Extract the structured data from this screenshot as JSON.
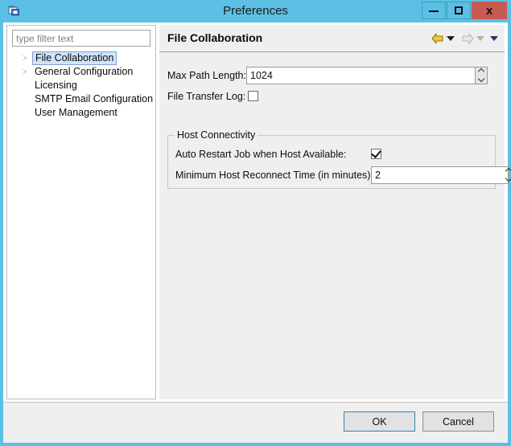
{
  "window": {
    "title": "Preferences",
    "icon": "folder-window-icon",
    "controls": {
      "minimize": "–",
      "maximize": "▢",
      "close": "x"
    },
    "accent_title_bar": "#5cc0e4",
    "accent_close": "#c75b51"
  },
  "sidebar": {
    "filter": {
      "placeholder": "type filter text",
      "value": ""
    },
    "items": [
      {
        "label": "File Collaboration",
        "expandable": true,
        "selected": true
      },
      {
        "label": "General Configuration",
        "expandable": true,
        "selected": false
      },
      {
        "label": "Licensing",
        "expandable": false,
        "selected": false
      },
      {
        "label": "SMTP Email Configuration",
        "expandable": false,
        "selected": false
      },
      {
        "label": "User Management",
        "expandable": false,
        "selected": false
      }
    ]
  },
  "content": {
    "title": "File Collaboration",
    "nav": {
      "back": "back-arrow",
      "back_menu": "back-dropdown",
      "forward": "forward-arrow",
      "forward_menu": "forward-dropdown",
      "menu": "view-menu",
      "back_color": "#e8b230",
      "forward_color": "#d8d8d8",
      "menu_color": "#3b2d63"
    },
    "fields": {
      "max_path_length": {
        "label": "Max Path Length:",
        "value": "1024"
      },
      "file_transfer_log": {
        "label": "File Transfer Log:",
        "checked": false
      }
    },
    "group": {
      "legend": "Host Connectivity",
      "auto_restart": {
        "label": "Auto Restart Job when Host Available:",
        "checked": true
      },
      "min_reconnect": {
        "label": "Minimum Host Reconnect Time (in minutes):",
        "value": "2"
      }
    }
  },
  "footer": {
    "ok_label": "OK",
    "cancel_label": "Cancel"
  }
}
